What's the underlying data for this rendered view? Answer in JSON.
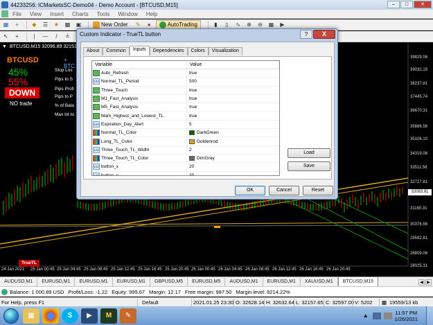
{
  "window": {
    "title": "44233256: ICMarketsSC-Demo04 - Demo Account - [BTCUSD,M15]"
  },
  "menu": [
    "File",
    "View",
    "Insert",
    "Charts",
    "Tools",
    "Window",
    "Help"
  ],
  "toolbar": {
    "new_order": "New Order",
    "autotrading": "AutoTrading"
  },
  "chart": {
    "header": "BTCUSD,M15  32096.89 32151.40 32",
    "panel_symbol": "BTCUSD",
    "buy_pct": "45%",
    "sell_pct": "55%",
    "signal": "DOWN",
    "status": "NO trade",
    "side_labels": [
      "Stop Los",
      "Pips to S",
      "Pips Profi",
      "Pips to P",
      "% of Bala",
      "Max lot to"
    ],
    "side_plus": "+ BTC",
    "current_price": "32083.81",
    "price_labels": [
      "39829.06",
      "39032.19",
      "38237.81",
      "37445.74",
      "36670.31",
      "35886.56",
      "35106.10",
      "34319.06",
      "33511.56",
      "32727.81",
      "31160.31",
      "30376.56",
      "29592.81",
      "28809.06",
      "28025.31"
    ],
    "time_labels": [
      "24 Jan 2021",
      "25 Jan 00:45",
      "25 Jan 04:45",
      "25 Jan 08:45",
      "25 Jan 12:45",
      "25 Jan 16:45",
      "25 Jan 20:45",
      "26 Jan 00:45",
      "26 Jan 04:45",
      "26 Jan 08:45",
      "26 Jan 12:45",
      "26 Jan 16:45",
      "26 Jan 20:45"
    ],
    "indicator_label": "TrueTL",
    "colors": {
      "bull": "#00c800",
      "bear": "#ff0000",
      "goldenrod": "#daa520",
      "dimgray": "#696969"
    }
  },
  "tabs": [
    "AUDUSD,M1",
    "EURUSD,M1",
    "EURUSD,M1",
    "EURUSD,M1",
    "GBPUSD,M5",
    "EURUSD,M5",
    "AUDUSD,M1",
    "EURUSD,M1",
    "XAUUSD,M1",
    "BTCUSD,M15"
  ],
  "active_tab": "BTCUSD,M15",
  "balance": {
    "balance": "Balance: 1 000.89 USD",
    "profit": "Profit/Loss: -1.22",
    "equity": "Equity: 999.67",
    "margin": "Margin: 12.17",
    "free_margin": "Free margin: 987.50",
    "margin_level": "Margin level: 8214.22%"
  },
  "status": {
    "help": "For Help, press F1",
    "profile": "Default",
    "datetime": "2021.01.25 23:30",
    "open": "O: 32628.14",
    "high": "H: 32632.64",
    "low": "L: 32157.65",
    "close": "C: 32597.00",
    "volume": "V: 5202",
    "traffic": "19559/13 kb"
  },
  "taskbar": {
    "time": "11:57 PM",
    "date": "1/26/2021"
  },
  "dialog": {
    "title": "Custom Indicator - TrueTL button",
    "help": "?",
    "close": "X",
    "tabs": [
      "About",
      "Common",
      "Inputs",
      "Dependencies",
      "Colors",
      "Visualization"
    ],
    "active_tab": "Inputs",
    "col_variable": "Variable",
    "col_value": "Value",
    "params": [
      {
        "type": "bool",
        "icon": "",
        "name": "Auto_Refresh",
        "value": "true"
      },
      {
        "type": "int",
        "icon": "123",
        "name": "Normal_TL_Period",
        "value": "500"
      },
      {
        "type": "bool",
        "icon": "",
        "name": "Three_Touch",
        "value": "true"
      },
      {
        "type": "bool",
        "icon": "",
        "name": "M1_Fast_Analysis",
        "value": "true"
      },
      {
        "type": "bool",
        "icon": "",
        "name": "M5_Fast_Analysis",
        "value": "true"
      },
      {
        "type": "bool",
        "icon": "",
        "name": "Mark_Highest_and_Lowest_TL",
        "value": "true"
      },
      {
        "type": "int",
        "icon": "123",
        "name": "Expiration_Day_Alert",
        "value": "5"
      },
      {
        "type": "color",
        "icon": "",
        "name": "Normal_TL_Color",
        "value": "DarkGreen",
        "swatch": "#006400"
      },
      {
        "type": "color",
        "icon": "",
        "name": "Long_TL_Color",
        "value": "Goldenrod",
        "swatch": "#daa520"
      },
      {
        "type": "int",
        "icon": "123",
        "name": "Three_Touch_TL_Widht",
        "value": "2"
      },
      {
        "type": "color",
        "icon": "",
        "name": "Three_Touch_TL_Color",
        "value": "DimGray",
        "swatch": "#696969"
      },
      {
        "type": "int",
        "icon": "123",
        "name": "button_x",
        "value": "20"
      },
      {
        "type": "int",
        "icon": "123",
        "name": "button_y",
        "value": "30"
      }
    ],
    "load": "Load",
    "save": "Save",
    "ok": "OK",
    "cancel": "Cancel",
    "reset": "Reset"
  }
}
